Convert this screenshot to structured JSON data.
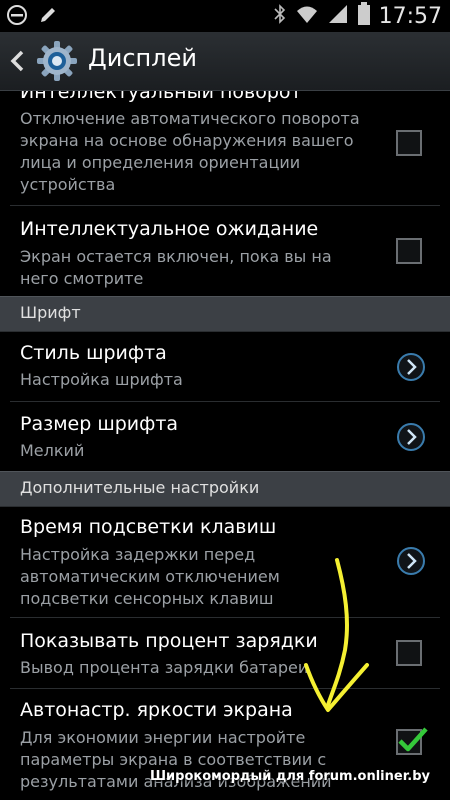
{
  "status_bar": {
    "time": "17:57",
    "icons": [
      "block-icon",
      "pencil-icon",
      "bluetooth-icon",
      "wifi-icon",
      "signal-icon",
      "battery-icon"
    ]
  },
  "header": {
    "title": "Дисплей",
    "icon": "gear-icon",
    "back_icon": "chevron-left-icon"
  },
  "items": [
    {
      "title": "Интеллектуальный поворот",
      "summary_lines": [
        "Отключение автоматического поворота",
        "экрана на основе обнаружения вашего",
        "лица и определения ориентации",
        "устройства"
      ],
      "control": "checkbox",
      "checked": false
    },
    {
      "title": "Интеллектуальное ожидание",
      "summary_lines": [
        "Экран остается включен, пока вы на",
        "него смотрите"
      ],
      "control": "checkbox",
      "checked": false
    }
  ],
  "categories": [
    "Шрифт",
    "Дополнительные настройки"
  ],
  "font_items": [
    {
      "title": "Стиль шрифта",
      "summary": "Настройка шрифта",
      "control": "chevron"
    },
    {
      "title": "Размер шрифта",
      "summary": "Мелкий",
      "control": "chevron"
    }
  ],
  "advanced_items": [
    {
      "title": "Время подсветки клавиш",
      "summary_lines": [
        "Настройка задержки перед",
        "автоматическим отключением",
        "подсветки сенсорных клавиш"
      ],
      "control": "chevron"
    },
    {
      "title": "Показывать процент зарядки",
      "summary_lines": [
        "Вывод процента зарядки батареи"
      ],
      "control": "checkbox",
      "checked": false
    },
    {
      "title": "Автонастр. яркости экрана",
      "summary_lines": [
        "Для экономии энергии настройте",
        "параметры экрана в соответствии с",
        "результатами анализа изображений"
      ],
      "control": "checkbox",
      "checked": true
    }
  ],
  "watermark": "Широкомордый для forum.onliner.by",
  "colors": {
    "checkmark": "#35c93a",
    "annotation": "#f5f032",
    "chevron": "#2f6f9a"
  }
}
